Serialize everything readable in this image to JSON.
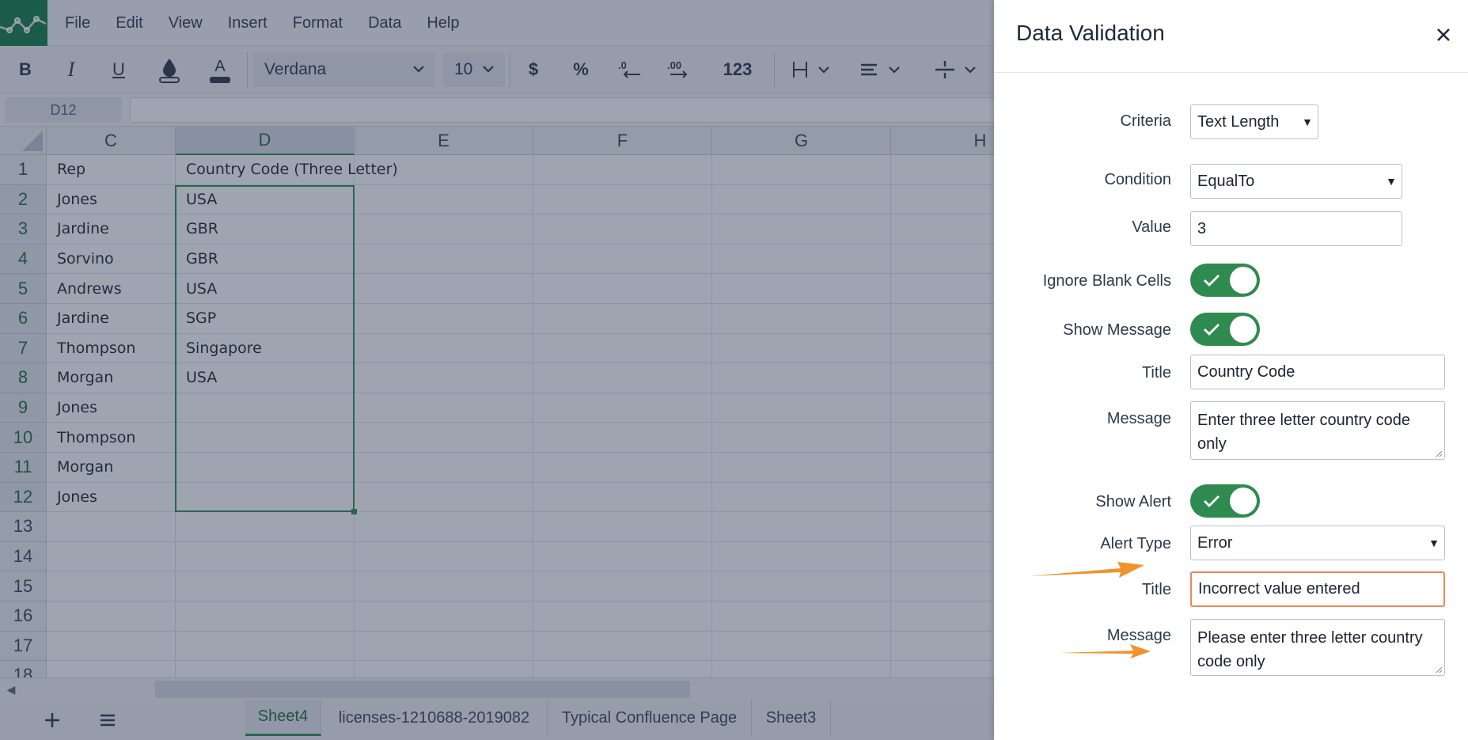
{
  "menu": [
    "File",
    "Edit",
    "View",
    "Insert",
    "Format",
    "Data",
    "Help"
  ],
  "toolbar": {
    "bold": "B",
    "italic": "I",
    "underline": "U",
    "font_name": "Verdana",
    "font_size": "10",
    "currency": "$",
    "percent": "%",
    "number_format": "123"
  },
  "namebox": "D12",
  "columns": [
    "C",
    "D",
    "E",
    "F",
    "G",
    "H"
  ],
  "rows": [
    "1",
    "2",
    "3",
    "4",
    "5",
    "6",
    "7",
    "8",
    "9",
    "10",
    "11",
    "12",
    "13",
    "14",
    "15",
    "16",
    "17",
    "18"
  ],
  "cells": {
    "C": [
      "Rep",
      "Jones",
      "Jardine",
      "Sorvino",
      "Andrews",
      "Jardine",
      "Thompson",
      "Morgan",
      "Jones",
      "Thompson",
      "Morgan",
      "Jones",
      "",
      "",
      "",
      "",
      "",
      ""
    ],
    "D": [
      "Country Code (Three Letter)",
      "USA",
      "GBR",
      "GBR",
      "USA",
      "SGP",
      "Singapore",
      "USA",
      "",
      "",
      "",
      "",
      "",
      "",
      "",
      "",
      "",
      ""
    ]
  },
  "sheets": [
    "Sheet4",
    "licenses-1210688-2019082",
    "Typical Confluence Page",
    "Sheet3"
  ],
  "panel": {
    "title": "Data Validation",
    "criteria_label": "Criteria",
    "criteria_value": "Text Length",
    "condition_label": "Condition",
    "condition_value": "EqualTo",
    "value_label": "Value",
    "value_value": "3",
    "ignore_blank_label": "Ignore Blank Cells",
    "show_message_label": "Show Message",
    "message_title_label": "Title",
    "message_title_value": "Country Code",
    "message_label": "Message",
    "message_value": "Enter three letter country code only",
    "show_alert_label": "Show Alert",
    "alert_type_label": "Alert Type",
    "alert_type_value": "Error",
    "alert_title_label": "Title",
    "alert_title_value": "Incorrect value entered",
    "alert_message_label": "Message",
    "alert_message_value": "Please enter three letter country code only"
  },
  "colors": {
    "accent": "#2f8a4f",
    "focus": "#e8895a",
    "arrow": "#f0922e"
  }
}
